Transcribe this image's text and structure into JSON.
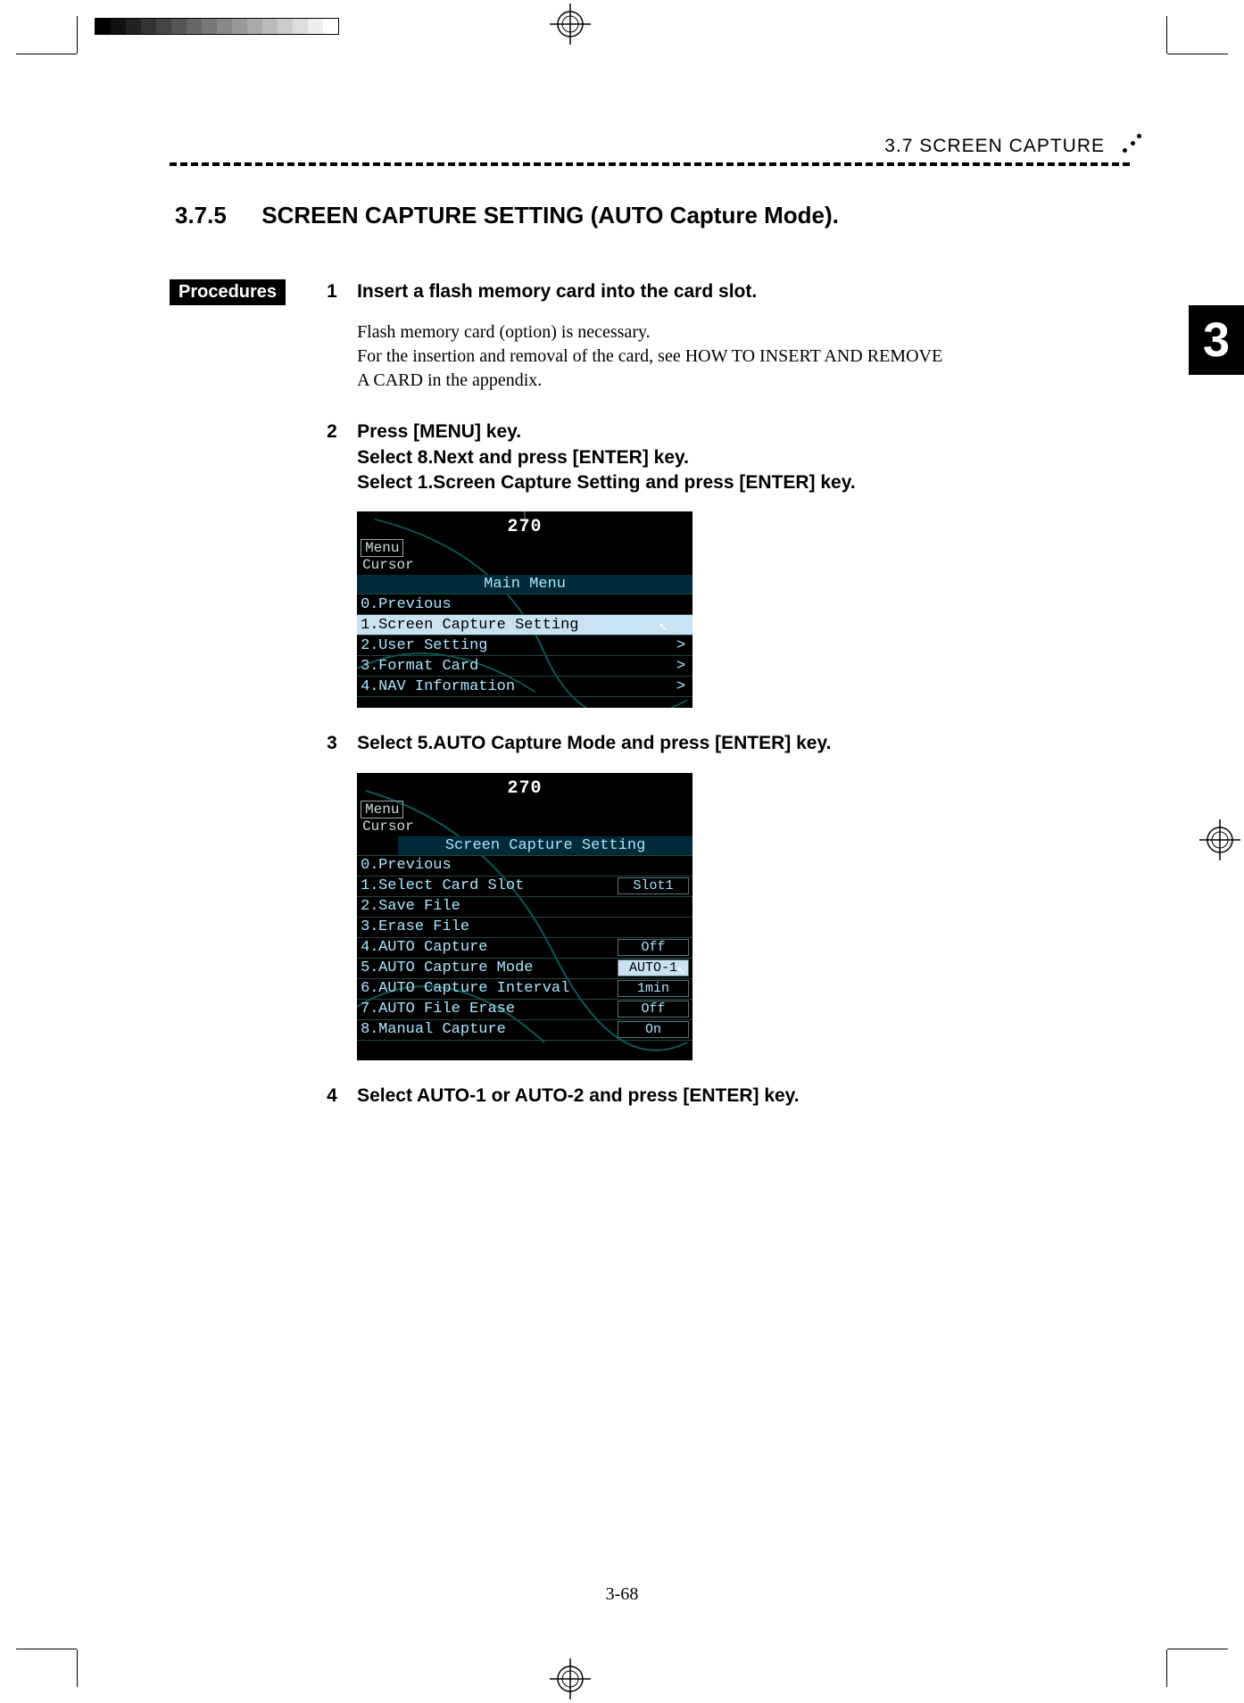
{
  "header": {
    "section": "3.7   SCREEN  CAPTURE"
  },
  "chapter_tab": "3",
  "heading": {
    "number": "3.7.5",
    "title": "SCREEN CAPTURE SETTING (AUTO Capture Mode)."
  },
  "procedures_label": "Procedures",
  "steps": {
    "s1": {
      "num": "1",
      "title": "Insert a flash memory card into the card slot.",
      "body1": "Flash memory card (option) is necessary.",
      "body2": "For the insertion and removal of the card, see HOW TO INSERT AND REMOVE A CARD in the appendix."
    },
    "s2": {
      "num": "2",
      "line1": "Press [MENU] key.",
      "line2": "Select   8.Next   and press [ENTER] key.",
      "line3": "Select   1.Screen Capture Setting and press [ENTER] key."
    },
    "s3": {
      "num": "3",
      "title": "Select 5.AUTO Capture Mode and press [ENTER] key."
    },
    "s4": {
      "num": "4",
      "title": "Select   AUTO-1 or AUTO-2   and press [ENTER] key."
    }
  },
  "screenshot1": {
    "compass": "270",
    "menu_btn": "Menu",
    "cursor_label": "Cursor",
    "title": "Main Menu",
    "items": [
      {
        "idx": "0.",
        "label": "Previous",
        "chev": ""
      },
      {
        "idx": "1.",
        "label": "Screen Capture Setting",
        "chev": ">",
        "selected": true
      },
      {
        "idx": "2.",
        "label": "User Setting",
        "chev": ">"
      },
      {
        "idx": "3.",
        "label": "Format Card",
        "chev": ">"
      },
      {
        "idx": "4.",
        "label": "NAV Information",
        "chev": ">"
      }
    ]
  },
  "screenshot2": {
    "compass": "270",
    "menu_btn": "Menu",
    "cursor_label": "Cursor",
    "title": "Screen Capture Setting",
    "items": [
      {
        "idx": "0.",
        "label": "Previous",
        "val": ""
      },
      {
        "idx": "1.",
        "label": "Select Card Slot",
        "val": "Slot1"
      },
      {
        "idx": "2.",
        "label": "Save File",
        "val": ""
      },
      {
        "idx": "3.",
        "label": "Erase File",
        "val": ""
      },
      {
        "idx": "4.",
        "label": "AUTO Capture",
        "val": "Off"
      },
      {
        "idx": "5.",
        "label": "AUTO Capture Mode",
        "val": "AUTO-1",
        "selected": true
      },
      {
        "idx": "6.",
        "label": "AUTO Capture Interval",
        "val": "1min"
      },
      {
        "idx": "7.",
        "label": "AUTO File Erase",
        "val": "Off"
      },
      {
        "idx": "8.",
        "label": "Manual Capture",
        "val": "On"
      }
    ]
  },
  "page_number": "3-68"
}
